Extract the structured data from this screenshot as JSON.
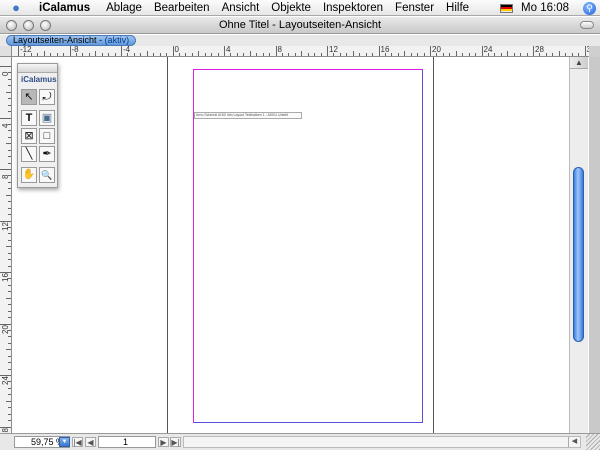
{
  "menubar": {
    "app_name": "iCalamus",
    "items": [
      "Ablage",
      "Bearbeiten",
      "Ansicht",
      "Objekte",
      "Inspektoren",
      "Fenster",
      "Hilfe"
    ],
    "clock": "Mo 16:08",
    "flag_icon": "german-flag-icon",
    "search_icon": "spotlight-icon"
  },
  "window": {
    "title": "Ohne Titel - Layoutseiten-Ansicht"
  },
  "doc_tab": {
    "label": "Layoutseiten-Ansicht",
    "separator": " - ",
    "state": "(aktiv)"
  },
  "ruler_top": {
    "labels": [
      "-12",
      "-8",
      "-4",
      "0",
      "4",
      "8",
      "12",
      "16",
      "20",
      "24",
      "28",
      "32"
    ]
  },
  "ruler_left": {
    "labels": [
      "0",
      "4",
      "8",
      "12",
      "16",
      "20",
      "24",
      "28"
    ]
  },
  "text_frame": {
    "text": "Arno Schmidt #150 Info Layout Textbalken 1 - AKKU Unteilt"
  },
  "palette": {
    "title": "iCalamus",
    "tools": [
      {
        "name": "arrow-icon",
        "glyph": "↖"
      },
      {
        "name": "rotate-icon",
        "glyph": "⤾"
      },
      {
        "name": "text-tool-icon",
        "glyph": "T"
      },
      {
        "name": "image-tool-icon",
        "glyph": "▣"
      },
      {
        "name": "picture-frame-icon",
        "glyph": "⊠"
      },
      {
        "name": "rectangle-icon",
        "glyph": "□"
      },
      {
        "name": "line-icon",
        "glyph": "╲"
      },
      {
        "name": "pen-icon",
        "glyph": "✒"
      },
      {
        "name": "hand-icon",
        "glyph": "✋"
      },
      {
        "name": "magnifier-icon",
        "glyph": "🔍"
      }
    ]
  },
  "bottom": {
    "zoom_value": "59,75 %",
    "page_value": "1",
    "nav_first": "|◀",
    "nav_prev": "◀",
    "nav_next": "▶",
    "nav_last": "▶|"
  }
}
